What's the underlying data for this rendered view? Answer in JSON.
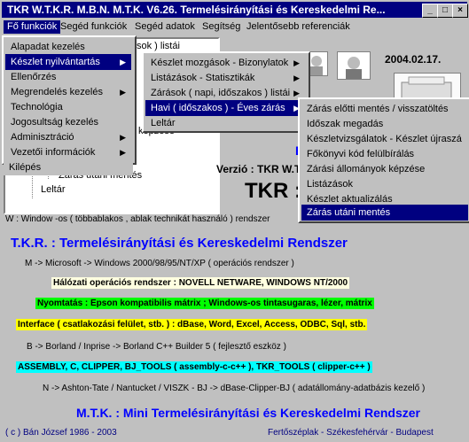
{
  "window": {
    "title": "TKR W.T.K.R. M.B.N. M.T.K. V6.26. Termelésirányítási és Kereskedelmi Re...",
    "btn_min": "_",
    "btn_max": "□",
    "btn_close": "×"
  },
  "menubar": {
    "items": [
      "Fő funkciók",
      "Segéd funkciók",
      "Segéd adatok",
      "Segítség",
      "Jelentősebb referenciák"
    ]
  },
  "tree": {
    "lines": [
      "sok ) listái",
      "képzése",
      "Zárás utáni mentés",
      "Leltár"
    ]
  },
  "menu1": {
    "items": [
      "Alapadat kezelés",
      "Készlet nyilvántartás",
      "Ellenőrzés",
      "Megrendelés kezelés",
      "Technológia",
      "Jogosultság kezelés",
      "Adminisztráció",
      "Vezetői információk",
      "Kilépés"
    ]
  },
  "menu2": {
    "items": [
      "Készlet mozgások - Bizonylatok",
      "Listázások - Statisztikák",
      "Zárások ( napi, időszakos ) listái",
      "Havi ( időszakos ) - Éves zárás",
      "Leltár"
    ]
  },
  "menu3": {
    "items": [
      "Zárás előtti mentés / visszatöltés",
      "Időszak megadás",
      "Készletvizsgálatok - Készlet újraszá",
      "Főkönyvi kód felülbírálás",
      "Zárási állományok képzése",
      "Listázások",
      "Készlet aktualizálás",
      "Zárás utáni mentés"
    ]
  },
  "header": {
    "date": "2004.02.17.",
    "verzio": "Verzió : TKR W.T",
    "tkr": "TKR :",
    "letter_b": "B"
  },
  "content": {
    "w_line": "W : Window -os ( többablakos , ablak technikát használó ) rendszer",
    "tkr_title": "T.K.R. : Termelésirányítási és Kereskedelmi Rendszer",
    "m_line": "M -> Microsoft -> Windows 2000/98/95/NT/XP        ( operációs rendszer )",
    "halozati": "Hálózati operációs rendszer : NOVELL NETWARE, WINDOWS NT/2000",
    "nyomtatas": "Nyomtatás : Epson kompatibilis mátrix ;  Windows-os tintasugaras, lézer, mátrix",
    "interface": "Interface ( csatlakozási felület, stb. )  : dBase, Word, Excel, Access, ODBC, Sql, stb.",
    "b_line": "B -> Borland / Inprise -> Borland C++ Builder 5    ( fejlesztő eszköz )",
    "assembly": "ASSEMBLY, C, CLIPPER, BJ_TOOLS ( assembly-c-c++ ), TKR_TOOLS ( clipper-c++ )",
    "n_line": "N -> Ashton-Tate / Nantucket / VISZK - BJ -> dBase-Clipper-BJ    ( adatállomány-adatbázis kezelő )",
    "mtk_title": "M.T.K. : Mini Termelésirányítási és Kereskedelmi Rendszer"
  },
  "status": {
    "left": "( c ) Bán József 1986 - 2003",
    "right": "Fertőszéplak - Székesfehérvár - Budapest"
  }
}
